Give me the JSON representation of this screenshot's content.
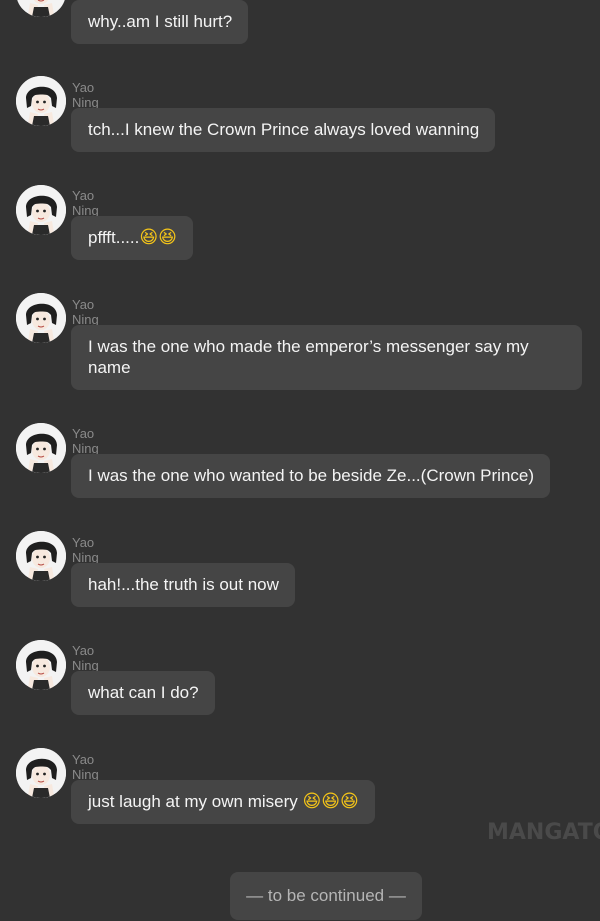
{
  "messages": [
    {
      "sender": "",
      "text": "why..am I still hurt?"
    },
    {
      "sender": "Yao Ning",
      "text": "tch...I knew the Crown Prince always loved wanning"
    },
    {
      "sender": "Yao Ning",
      "text": "pffft.....",
      "emoji": "😆😆"
    },
    {
      "sender": "Yao Ning",
      "text": "I was the one who made the emperor’s messenger say my name"
    },
    {
      "sender": "Yao Ning",
      "text": "I was the one who wanted to be beside Ze...(Crown Prince)"
    },
    {
      "sender": "Yao Ning",
      "text": "hah!...the truth is out now"
    },
    {
      "sender": "Yao Ning",
      "text": "what can I do?"
    },
    {
      "sender": "Yao Ning",
      "text": "just laugh at my own misery",
      "emoji": "😆😆😆"
    }
  ],
  "watermark": "MANGATO",
  "footer": {
    "label": "— to be continued —"
  },
  "avatar": {
    "icon": "user-avatar-icon"
  },
  "colors": {
    "background": "#323232",
    "bubble": "#454545",
    "sender": "#8a8a8a",
    "emoji": "#f5c518"
  }
}
